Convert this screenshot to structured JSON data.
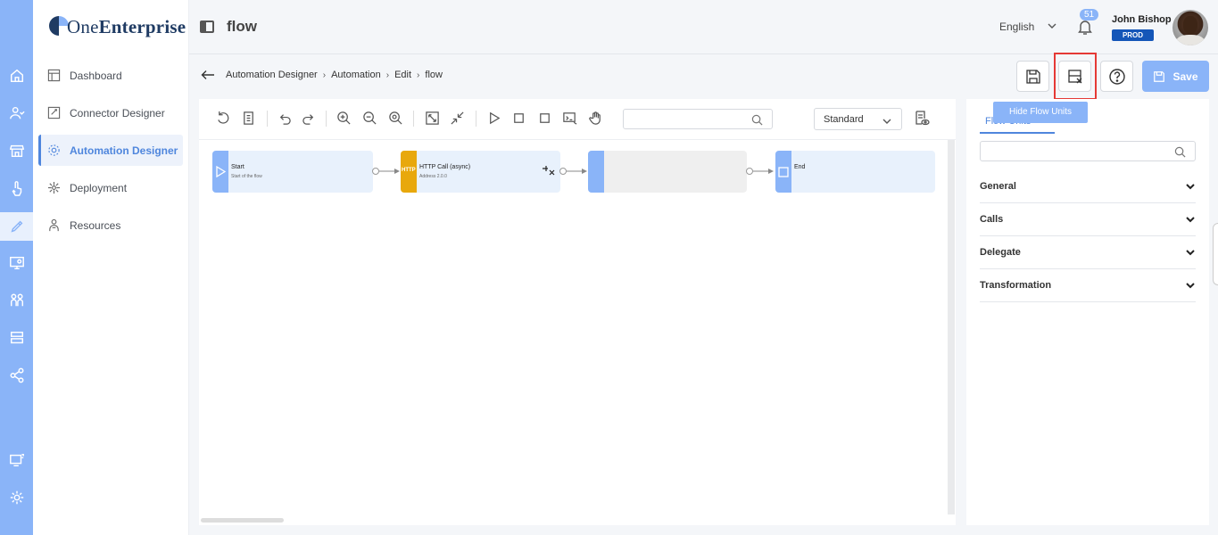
{
  "app": {
    "logo_word_light": "One",
    "logo_word_bold": "Enterprise",
    "page_title": "flow"
  },
  "sidebar": {
    "items": [
      {
        "label": "Dashboard",
        "icon": "dashboard-icon"
      },
      {
        "label": "Connector Designer",
        "icon": "connector-icon"
      },
      {
        "label": "Automation Designer",
        "icon": "automation-icon",
        "active": true
      },
      {
        "label": "Deployment",
        "icon": "deployment-icon"
      },
      {
        "label": "Resources",
        "icon": "resources-icon"
      }
    ]
  },
  "header": {
    "language": "English",
    "notifications_count": "51",
    "user_name": "John Bishop",
    "environment": "PROD"
  },
  "breadcrumb": [
    "Automation Designer",
    "Automation",
    "Edit",
    "flow"
  ],
  "actions": {
    "save_label": "Save",
    "tooltip": "Hide Flow Units"
  },
  "toolbar": {
    "view_mode": "Standard",
    "search_value": ""
  },
  "flow": {
    "nodes": [
      {
        "title": "Start",
        "subtitle": "Start of the flow",
        "kind": "start"
      },
      {
        "title": "HTTP Call (async)",
        "subtitle": "Address 2.0.0",
        "kind": "http",
        "badge": "HTTP"
      },
      {
        "title": "",
        "subtitle": "",
        "kind": "empty"
      },
      {
        "title": "End",
        "subtitle": "",
        "kind": "end"
      }
    ]
  },
  "flow_units_panel": {
    "tab_label": "Flow Units",
    "search_value": "",
    "categories": [
      "General",
      "Calls",
      "Delegate",
      "Transformation"
    ]
  },
  "colors": {
    "accent": "#8ab4f8",
    "primary": "#4f86dd",
    "env_badge": "#1456b8",
    "http_node": "#e8a80c",
    "highlight": "#e53935"
  }
}
